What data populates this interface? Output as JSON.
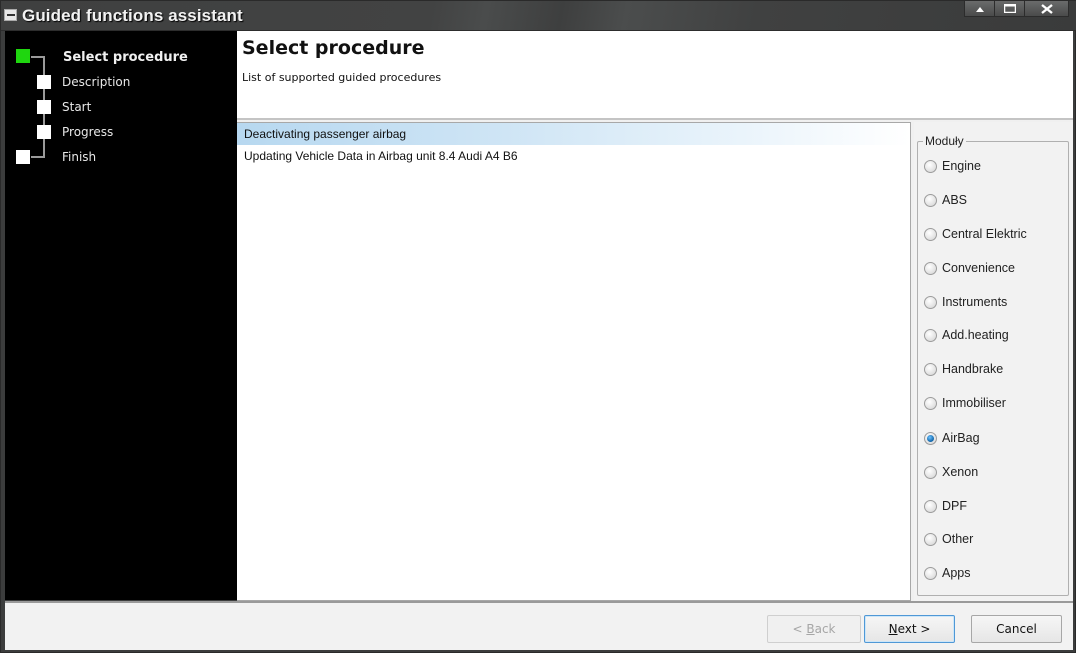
{
  "window": {
    "title": "Guided functions assistant",
    "controls": [
      "minimize",
      "maximize",
      "close"
    ]
  },
  "wizard_steps": [
    {
      "label": "Select procedure",
      "active": true
    },
    {
      "label": "Description",
      "active": false
    },
    {
      "label": "Start",
      "active": false
    },
    {
      "label": "Progress",
      "active": false
    },
    {
      "label": "Finish",
      "active": false
    }
  ],
  "header": {
    "title": "Select procedure",
    "subtitle": "List of supported guided procedures"
  },
  "procedures": [
    {
      "label": "Deactivating passenger airbag",
      "selected": true
    },
    {
      "label": "Updating Vehicle Data in Airbag unit 8.4 Audi A4 B6",
      "selected": false
    }
  ],
  "modules": {
    "legend": "Moduły",
    "selected": "AirBag",
    "options": [
      "Engine",
      "ABS",
      "Central Elektric",
      "Convenience",
      "Instruments",
      "Add.heating",
      "Handbrake",
      "Immobiliser",
      "AirBag",
      "Xenon",
      "DPF",
      "Other",
      "Apps"
    ]
  },
  "footer": {
    "back_prefix": "< ",
    "back_mnemonic": "B",
    "back_rest": "ack",
    "next_mnemonic": "N",
    "next_rest": "ext >",
    "cancel_label": "Cancel"
  },
  "colors": {
    "active_step": "#1fd60f",
    "selection": "#b7d8f0",
    "default_button_border": "#4f98d6"
  }
}
